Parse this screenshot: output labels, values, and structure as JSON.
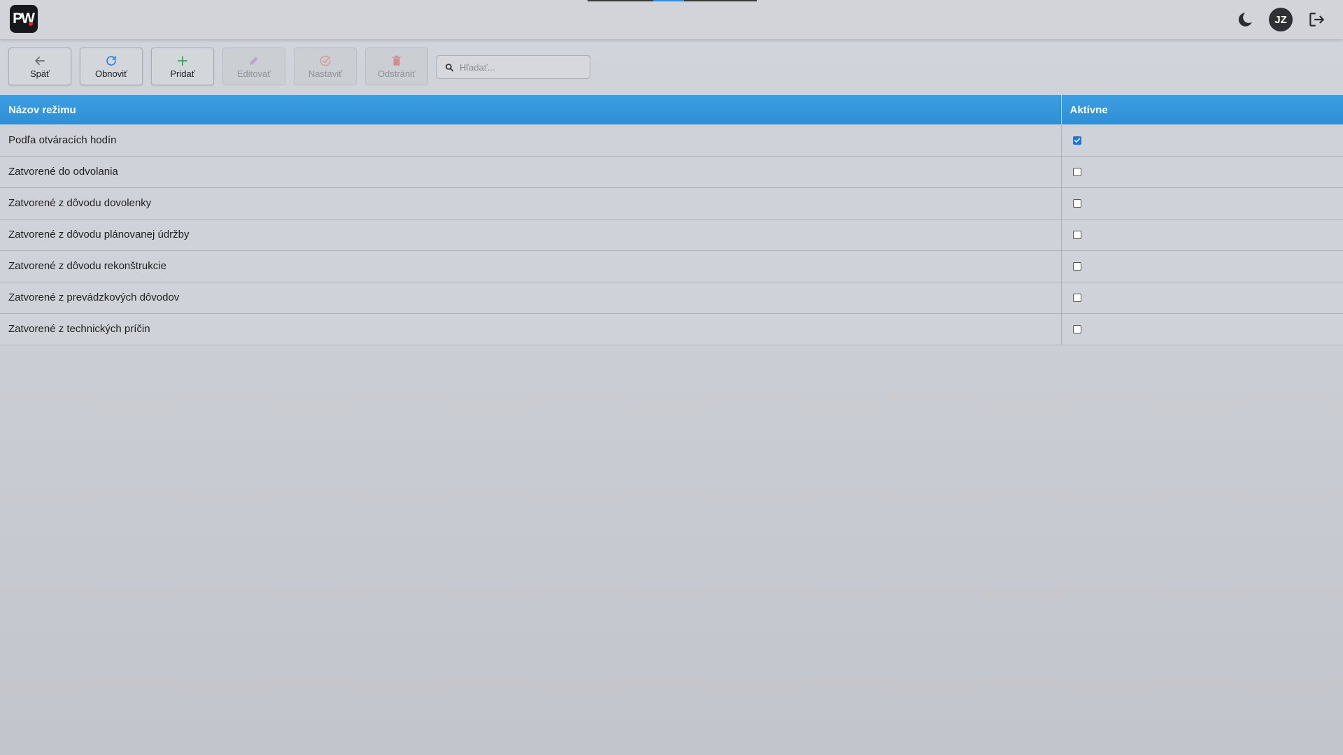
{
  "app": {
    "logo_text": "PW",
    "user_initials": "JZ",
    "icons": [
      "dark-mode-icon",
      "logout-icon"
    ]
  },
  "toolbar": {
    "buttons": [
      {
        "label": "Späť",
        "icon": "arrow-left-icon",
        "enabled": true,
        "color": "#6b6e74"
      },
      {
        "label": "Obnoviť",
        "icon": "refresh-icon",
        "enabled": true,
        "color": "#2d7fd3"
      },
      {
        "label": "Pridať",
        "icon": "plus-icon",
        "enabled": true,
        "color": "#2fa84f"
      },
      {
        "label": "Editovať",
        "icon": "pencil-icon",
        "enabled": false,
        "color": "#b06ad0"
      },
      {
        "label": "Nastaviť",
        "icon": "check-circle-icon",
        "enabled": false,
        "color": "#e06a5a"
      },
      {
        "label": "Odstrániť",
        "icon": "trash-icon",
        "enabled": false,
        "color": "#d9473f"
      }
    ],
    "search": {
      "placeholder": "Hľadať...",
      "value": ""
    }
  },
  "table": {
    "headers": {
      "name": "Názov režimu",
      "active": "Aktívne"
    },
    "rows": [
      {
        "name": "Podľa otváracích hodín",
        "active": true
      },
      {
        "name": "Zatvorené do odvolania",
        "active": false
      },
      {
        "name": "Zatvorené z dôvodu dovolenky",
        "active": false
      },
      {
        "name": "Zatvorené z dôvodu plánovanej údržby",
        "active": false
      },
      {
        "name": "Zatvorené z dôvodu rekonštrukcie",
        "active": false
      },
      {
        "name": "Zatvorené z prevádzkových dôvodov",
        "active": false
      },
      {
        "name": "Zatvorené z technických príčin",
        "active": false
      }
    ]
  },
  "colors": {
    "header_blue": "#2f8fd5",
    "checkbox_checked": "#1a73e8"
  }
}
